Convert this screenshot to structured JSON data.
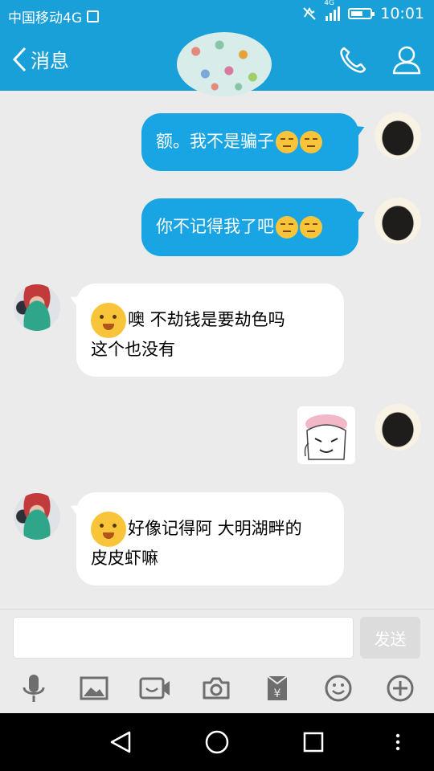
{
  "status_bar": {
    "carrier": "中国移动4G",
    "network": "4G",
    "time": "10:01"
  },
  "header": {
    "back_label": "消息"
  },
  "messages": [
    {
      "direction": "out",
      "text": "额。我不是骗子",
      "emoji": [
        "unamused-emoji",
        "unamused-emoji"
      ]
    },
    {
      "direction": "out",
      "text": "你不记得我了吧",
      "emoji": [
        "unamused-emoji",
        "unamused-emoji"
      ]
    },
    {
      "direction": "in",
      "line1": "噢 不劫钱是要劫色吗",
      "line2": "这个也没有"
    },
    {
      "direction": "out",
      "sticker": "cartoon-sticker"
    },
    {
      "direction": "in",
      "line1": "好像记得阿 大明湖畔的",
      "line2": "皮皮虾嘛"
    }
  ],
  "input": {
    "value": "",
    "send_label": "发送"
  },
  "toolbar_icons": [
    "microphone-icon",
    "image-icon",
    "video-icon",
    "camera-icon",
    "red-packet-icon",
    "emoji-icon",
    "plus-icon"
  ]
}
